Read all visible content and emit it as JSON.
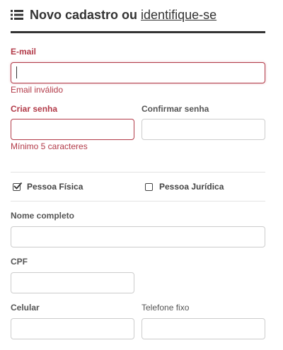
{
  "header": {
    "title": "Novo cadastro ou",
    "link": "identifique-se",
    "icon": "list-icon"
  },
  "form": {
    "email": {
      "label": "E-mail",
      "value": "",
      "error": "Email inválido"
    },
    "password": {
      "label": "Criar senha",
      "value": "",
      "error": "Mínimo 5 caracteres"
    },
    "confirm_password": {
      "label": "Confirmar senha",
      "value": ""
    },
    "person_type": {
      "options": [
        {
          "label": "Pessoa Física",
          "checked": true
        },
        {
          "label": "Pessoa Jurídica",
          "checked": false
        }
      ]
    },
    "full_name": {
      "label": "Nome completo",
      "value": ""
    },
    "cpf": {
      "label": "CPF",
      "value": ""
    },
    "mobile": {
      "label": "Celular",
      "value": ""
    },
    "phone": {
      "label": "Telefone fixo",
      "value": ""
    }
  },
  "colors": {
    "error": "#b23a48",
    "text": "#333333",
    "border": "#cccccc"
  }
}
